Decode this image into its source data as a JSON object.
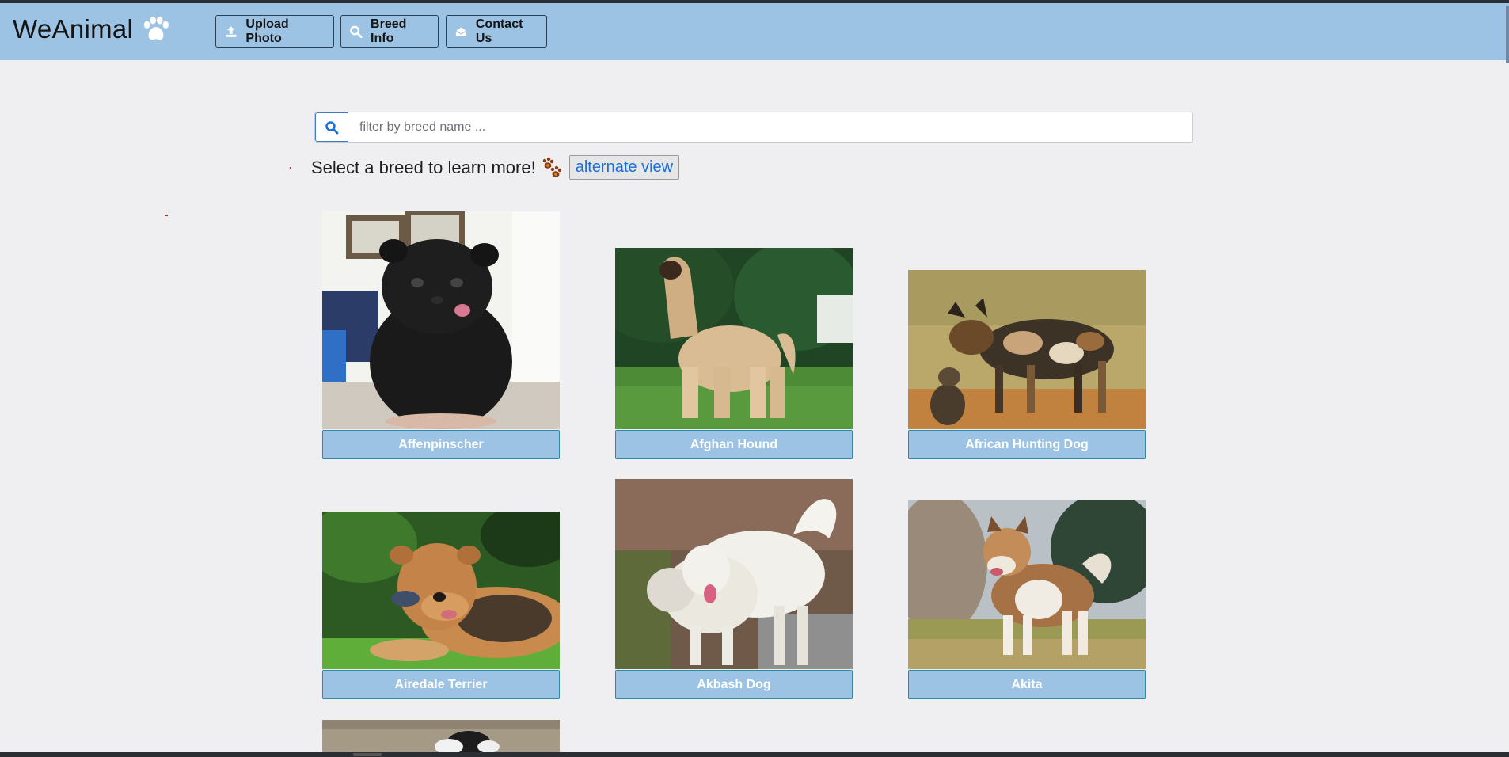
{
  "brand": {
    "name": "WeAnimal",
    "icon": "paw-icon"
  },
  "nav": [
    {
      "label": "Upload Photo",
      "icon": "upload-icon"
    },
    {
      "label": "Breed Info",
      "icon": "search-icon"
    },
    {
      "label": "Contact Us",
      "icon": "envelope-icon"
    }
  ],
  "search": {
    "placeholder": "filter by breed name ...",
    "value": ""
  },
  "prompt": {
    "text": "Select a breed to learn more!",
    "icon": "paws-icon",
    "alt_button": "alternate view"
  },
  "breeds": [
    {
      "name": "Affenpinscher"
    },
    {
      "name": "Afghan Hound"
    },
    {
      "name": "African Hunting Dog"
    },
    {
      "name": "Airedale Terrier"
    },
    {
      "name": "Akbash Dog"
    },
    {
      "name": "Akita"
    },
    {
      "name": ""
    }
  ],
  "colors": {
    "navbar": "#9cc3e4",
    "accent": "#1a6fd6",
    "background": "#efeff1"
  }
}
